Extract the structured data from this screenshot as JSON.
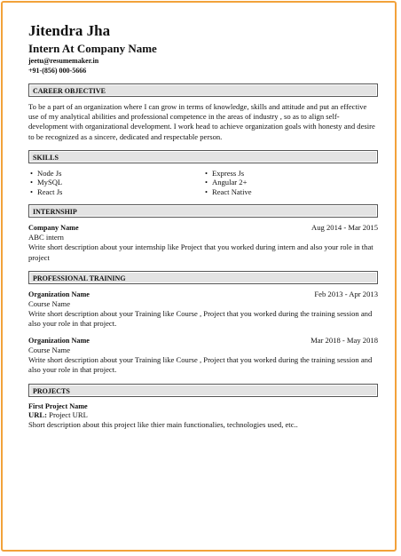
{
  "header": {
    "name": "Jitendra Jha",
    "role": "Intern At Company Name",
    "email": "jeetu@resumemaker.in",
    "phone": "+91-(856) 000-5666"
  },
  "career": {
    "heading": "CAREER OBJECTIVE",
    "text": "To be a part of an organization where I can grow in terms of knowledge, skills and attitude and put an effective use of my analytical abilities and professional competence in the areas of industry , so as to align self-development with organizational development. I work head to achieve organization goals with honesty and desire to be recognized as a sincere, dedicated and respectable person."
  },
  "skills": {
    "heading": "SKILLS",
    "col1": [
      "Node Js",
      "MySQL",
      "React Js"
    ],
    "col2": [
      "Express Js",
      "Angular 2+",
      "React Native"
    ]
  },
  "internship": {
    "heading": "INTERNSHIP",
    "company": "Company Name",
    "dates": "Aug 2014 - Mar 2015",
    "title": "ABC intern",
    "desc": "Write short description about your internship like Project that you worked during intern and also your role in that project"
  },
  "training": {
    "heading": "PROFESSIONAL TRAINING",
    "entries": [
      {
        "org": "Organization Name",
        "dates": "Feb 2013 - Apr 2013",
        "course": "Course Name",
        "desc": "Write short description about your Training like Course , Project that you worked during the training session and also your role in that project."
      },
      {
        "org": "Organization Name",
        "dates": "Mar 2018 - May 2018",
        "course": "Course Name",
        "desc": "Write short description about your Training like Course , Project that you worked during the training session and also your role in that project."
      }
    ]
  },
  "projects": {
    "heading": "PROJECTS",
    "name": "First Project Name",
    "url_label": "URL:",
    "url": "Project URL",
    "desc": "Short description about this project like thier main functionalies, technologies used, etc.."
  },
  "colors": {
    "frame_border": "#f2a23a",
    "section_bg": "#e3e3e3"
  }
}
